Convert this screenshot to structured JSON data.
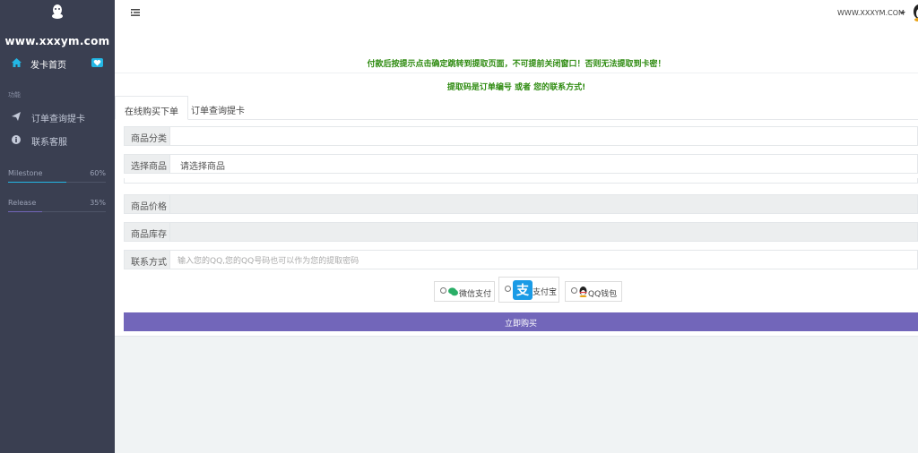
{
  "sidebar": {
    "brand": "www.xxxym.com",
    "home_label": "发卡首页",
    "section_label": "功能",
    "items": [
      {
        "label": "订单查询提卡",
        "icon": "paper-plane-icon"
      },
      {
        "label": "联系客服",
        "icon": "info-circle-icon"
      }
    ],
    "progress": [
      {
        "name": "Milestone",
        "percent_label": "60%",
        "value": 0.6,
        "color": "#23b7e5"
      },
      {
        "name": "Release",
        "percent_label": "35%",
        "value": 0.35,
        "color": "#7266ba"
      }
    ]
  },
  "header": {
    "site_name": "WWW.XXXYM.COM"
  },
  "notices": {
    "line1": "付款后按提示点击确定跳转到提取页面，不可提前关闭窗口！否则无法提取到卡密！",
    "line2": "提取码是订单编号 或者 您的联系方式!"
  },
  "tabs": [
    {
      "label": "在线购买下单",
      "active": true
    },
    {
      "label": "订单查询提卡",
      "active": false
    }
  ],
  "form": {
    "category_label": "商品分类",
    "product_label": "选择商品",
    "product_value": "请选择商品",
    "price_label": "商品价格",
    "stock_label": "商品库存",
    "contact_label": "联系方式",
    "contact_placeholder": "输入您的QQ,您的QQ号码也可以作为您的提取密码"
  },
  "payments": [
    {
      "label": "微信支付",
      "icon": "wechat-icon"
    },
    {
      "label": "支付宝",
      "icon": "alipay-icon"
    },
    {
      "label": "QQ钱包",
      "icon": "qq-penguin-icon"
    }
  ],
  "buy_label": "立即购买",
  "colors": {
    "sidebar_bg": "#3a3f51",
    "accent": "#7266ba",
    "info": "#23b7e5",
    "notice_green": "#2e8b10"
  }
}
